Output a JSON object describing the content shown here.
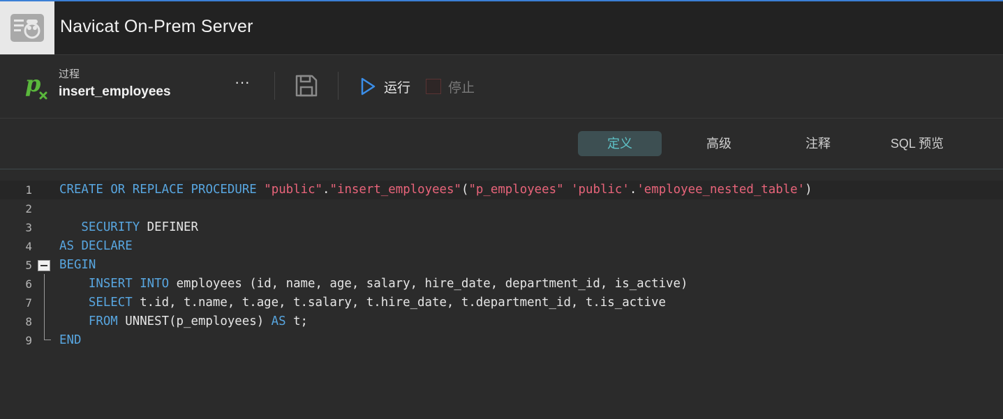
{
  "window": {
    "title": "Navicat On-Prem Server"
  },
  "toolbar": {
    "object_type": "过程",
    "object_name": "insert_employees",
    "more_label": "···",
    "run_label": "运行",
    "stop_label": "停止"
  },
  "tabs": [
    {
      "label": "定义",
      "active": true
    },
    {
      "label": "高级",
      "active": false
    },
    {
      "label": "注释",
      "active": false
    },
    {
      "label": "SQL 预览",
      "active": false
    }
  ],
  "colors": {
    "accent": "#3b7fd6",
    "keyword": "#58a6e0",
    "string": "#e8647a",
    "tab_active_text": "#5fc3c8",
    "proc_icon": "#5ab83c"
  },
  "editor": {
    "line_numbers": [
      "1",
      "2",
      "3",
      "4",
      "5",
      "6",
      "7",
      "8",
      "9"
    ],
    "lines": [
      [
        {
          "t": "kw",
          "v": "CREATE"
        },
        {
          "t": "p",
          "v": " "
        },
        {
          "t": "kw",
          "v": "OR"
        },
        {
          "t": "p",
          "v": " "
        },
        {
          "t": "kw",
          "v": "REPLACE"
        },
        {
          "t": "p",
          "v": " "
        },
        {
          "t": "kw",
          "v": "PROCEDURE"
        },
        {
          "t": "p",
          "v": " "
        },
        {
          "t": "str",
          "v": "\"public\""
        },
        {
          "t": "p",
          "v": "."
        },
        {
          "t": "str",
          "v": "\"insert_employees\""
        },
        {
          "t": "p",
          "v": "("
        },
        {
          "t": "str",
          "v": "\"p_employees\""
        },
        {
          "t": "p",
          "v": " "
        },
        {
          "t": "str",
          "v": "'public'"
        },
        {
          "t": "p",
          "v": "."
        },
        {
          "t": "str",
          "v": "'employee_nested_table'"
        },
        {
          "t": "p",
          "v": ")"
        }
      ],
      [],
      [
        {
          "t": "p",
          "v": "   "
        },
        {
          "t": "kw",
          "v": "SECURITY"
        },
        {
          "t": "p",
          "v": " DEFINER"
        }
      ],
      [
        {
          "t": "kw",
          "v": "AS"
        },
        {
          "t": "p",
          "v": " "
        },
        {
          "t": "kw",
          "v": "DECLARE"
        }
      ],
      [
        {
          "t": "kw",
          "v": "BEGIN"
        }
      ],
      [
        {
          "t": "p",
          "v": "    "
        },
        {
          "t": "kw",
          "v": "INSERT"
        },
        {
          "t": "p",
          "v": " "
        },
        {
          "t": "kw",
          "v": "INTO"
        },
        {
          "t": "p",
          "v": " employees (id, name, age, salary, hire_date, department_id, is_active)"
        }
      ],
      [
        {
          "t": "p",
          "v": "    "
        },
        {
          "t": "kw",
          "v": "SELECT"
        },
        {
          "t": "p",
          "v": " t.id, t.name, t.age, t.salary, t.hire_date, t.department_id, t.is_active"
        }
      ],
      [
        {
          "t": "p",
          "v": "    "
        },
        {
          "t": "kw",
          "v": "FROM"
        },
        {
          "t": "p",
          "v": " UNNEST(p_employees) "
        },
        {
          "t": "kw",
          "v": "AS"
        },
        {
          "t": "p",
          "v": " t;"
        }
      ],
      [
        {
          "t": "kw",
          "v": "END"
        }
      ]
    ]
  }
}
